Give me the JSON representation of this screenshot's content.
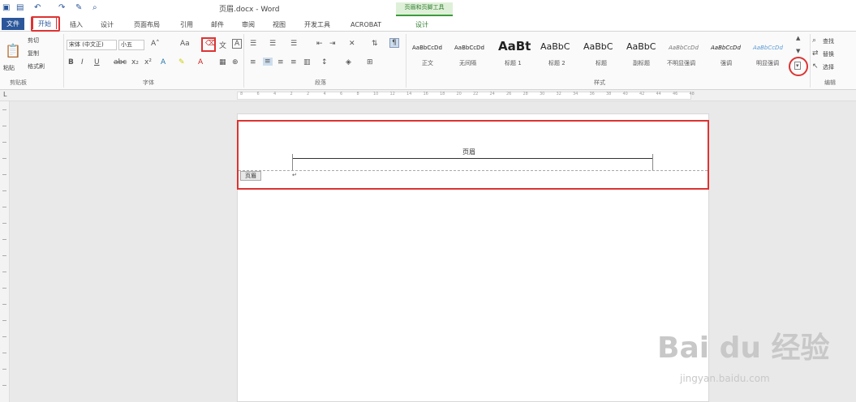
{
  "titlebar": {
    "title": "页眉.docx - Word",
    "context_tab": "页眉和页脚工具"
  },
  "tabs": [
    {
      "label": "文件"
    },
    {
      "label": "开始"
    },
    {
      "label": "插入"
    },
    {
      "label": "设计"
    },
    {
      "label": "页面布局"
    },
    {
      "label": "引用"
    },
    {
      "label": "邮件"
    },
    {
      "label": "审阅"
    },
    {
      "label": "视图"
    },
    {
      "label": "开发工具"
    },
    {
      "label": "ACROBAT"
    },
    {
      "label": "设计"
    }
  ],
  "clipboard": {
    "paste": "粘贴",
    "cut": "剪切",
    "copy": "复制",
    "painter": "格式刷",
    "label": "剪贴板"
  },
  "font": {
    "family": "宋体 (中文正)",
    "size": "小五",
    "label": "字体"
  },
  "paragraph": {
    "label": "段落"
  },
  "styles": {
    "label": "样式",
    "items": [
      {
        "preview": "AaBbCcDd",
        "name": "正文"
      },
      {
        "preview": "AaBbCcDd",
        "name": "无间隔"
      },
      {
        "preview": "AaBt",
        "name": "标题 1"
      },
      {
        "preview": "AaBbC",
        "name": "标题 2"
      },
      {
        "preview": "AaBbC",
        "name": "标题"
      },
      {
        "preview": "AaBbC",
        "name": "副标题"
      },
      {
        "preview": "AaBbCcDd",
        "name": "不明显强调"
      },
      {
        "preview": "AaBbCcDd",
        "name": "强调"
      },
      {
        "preview": "AaBbCcDd",
        "name": "明显强调"
      }
    ]
  },
  "editing": {
    "find": "查找",
    "replace": "替换",
    "select": "选择",
    "label": "编辑"
  },
  "ruler": {
    "ticks": [
      "8",
      "6",
      "4",
      "2",
      "2",
      "4",
      "6",
      "8",
      "10",
      "12",
      "14",
      "16",
      "18",
      "20",
      "22",
      "24",
      "26",
      "28",
      "30",
      "32",
      "34",
      "36",
      "38",
      "40",
      "42",
      "44",
      "46",
      "48"
    ]
  },
  "document": {
    "header_text": "页眉",
    "header_tag": "页眉",
    "para_mark": "↵"
  },
  "watermark": {
    "brand": "Bai du 经验",
    "url": "jingyan.baidu.com"
  }
}
